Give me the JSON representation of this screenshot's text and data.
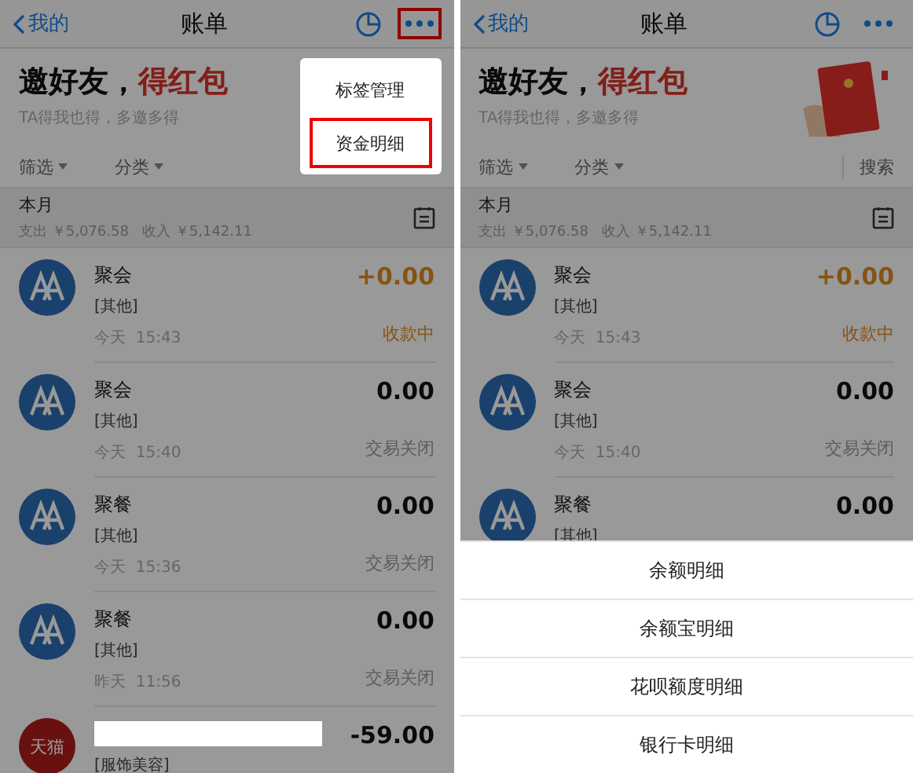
{
  "screens": [
    {
      "nav": {
        "back": "我的",
        "title": "账单",
        "more_marked": true
      },
      "banner": {
        "headline": "邀好友，",
        "highlight": "得红包",
        "subtitle": "TA得我也得，多邀多得"
      },
      "filters": [
        "筛选",
        "分类"
      ],
      "month": {
        "label": "本月",
        "summary": "支出 ￥5,076.58   收入 ￥5,142.11"
      },
      "transactions": [
        {
          "kind": "aa",
          "title": "聚会",
          "category": "[其他]",
          "time": "今天  15:43",
          "amount": "+0.00",
          "status": "收款中",
          "pending": true
        },
        {
          "kind": "aa",
          "title": "聚会",
          "category": "[其他]",
          "time": "今天  15:40",
          "amount": "0.00",
          "status": "交易关闭",
          "pending": false
        },
        {
          "kind": "aa",
          "title": "聚餐",
          "category": "[其他]",
          "time": "今天  15:36",
          "amount": "0.00",
          "status": "交易关闭",
          "pending": false
        },
        {
          "kind": "aa",
          "title": "聚餐",
          "category": "[其他]",
          "time": "昨天  11:56",
          "amount": "0.00",
          "status": "交易关闭",
          "pending": false
        },
        {
          "kind": "tmall",
          "avatar_text": "天猫",
          "redacted": true,
          "category": "[服饰美容]",
          "amount": "-59.00",
          "pending": false
        }
      ],
      "popover": [
        {
          "label": "标签管理",
          "marked": false
        },
        {
          "label": "资金明细",
          "marked": true
        }
      ]
    },
    {
      "nav": {
        "back": "我的",
        "title": "账单",
        "more_marked": false
      },
      "banner": {
        "headline": "邀好友，",
        "highlight": "得红包",
        "subtitle": "TA得我也得，多邀多得",
        "art": true
      },
      "filters": [
        "筛选",
        "分类"
      ],
      "search": "搜索",
      "month": {
        "label": "本月",
        "summary": "支出 ￥5,076.58   收入 ￥5,142.11"
      },
      "transactions": [
        {
          "kind": "aa",
          "title": "聚会",
          "category": "[其他]",
          "time": "今天  15:43",
          "amount": "+0.00",
          "status": "收款中",
          "pending": true
        },
        {
          "kind": "aa",
          "title": "聚会",
          "category": "[其他]",
          "time": "今天  15:40",
          "amount": "0.00",
          "status": "交易关闭",
          "pending": false
        },
        {
          "kind": "aa",
          "title": "聚餐",
          "category": "[其他]",
          "amount": "0.00",
          "pending": false
        }
      ],
      "sheet": [
        "余额明细",
        "余额宝明细",
        "花呗额度明细",
        "银行卡明细"
      ]
    }
  ]
}
